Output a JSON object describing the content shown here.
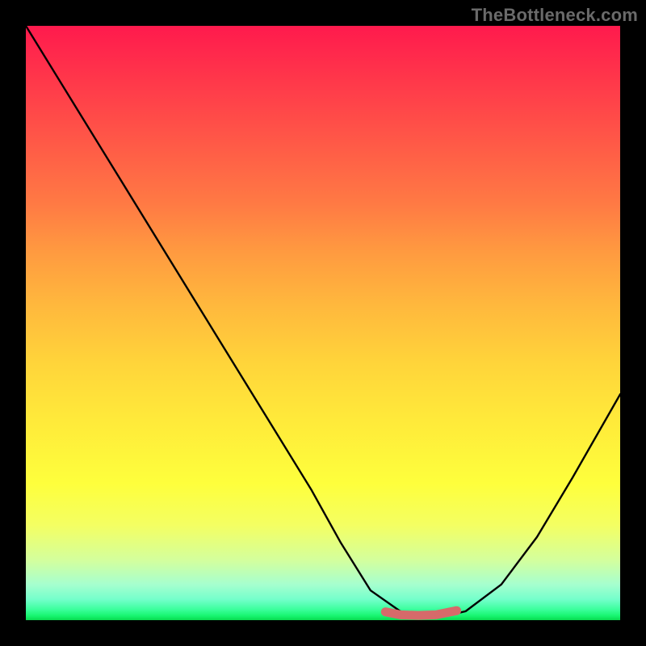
{
  "watermark": "TheBottleneck.com",
  "chart_data": {
    "type": "line",
    "title": "",
    "xlabel": "",
    "ylabel": "",
    "xlim": [
      0,
      100
    ],
    "ylim": [
      0,
      100
    ],
    "grid": false,
    "legend": false,
    "series": [
      {
        "name": "bottleneck-curve",
        "x": [
          0,
          8,
          16,
          24,
          32,
          40,
          48,
          53,
          58,
          63,
          68,
          71,
          74,
          80,
          86,
          92,
          100
        ],
        "values": [
          100,
          87,
          74,
          61,
          48,
          35,
          22,
          13,
          5,
          1.5,
          0.8,
          0.8,
          1.5,
          6,
          14,
          24,
          38
        ]
      },
      {
        "name": "bottleneck-highlight",
        "x": [
          60.5,
          63,
          66,
          69,
          72.5
        ],
        "values": [
          1.4,
          0.9,
          0.8,
          0.9,
          1.6
        ]
      }
    ],
    "background_gradient": {
      "top": "#ff1a4d",
      "mid": "#ffe93a",
      "bottom": "#08d94f"
    },
    "highlight_color": "#d66a6a"
  }
}
